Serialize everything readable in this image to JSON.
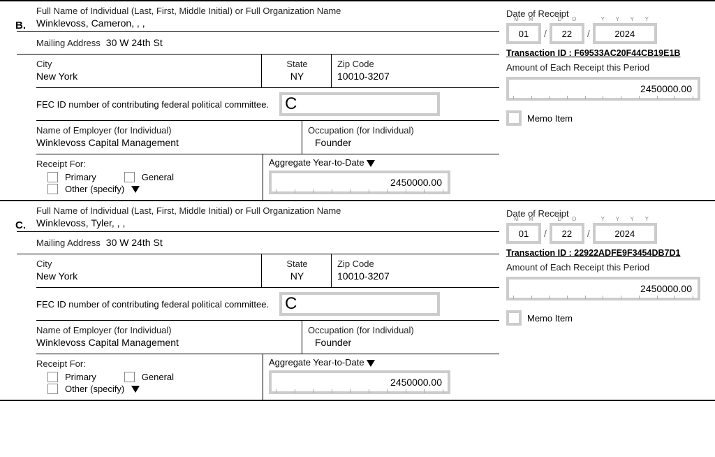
{
  "labels": {
    "fullName": "Full Name of Individual (Last, First, Middle Initial) or Full Organization Name",
    "mailingAddress": "Mailing Address",
    "city": "City",
    "state": "State",
    "zip": "Zip Code",
    "fecId": "FEC ID number of contributing federal political committee.",
    "employer": "Name of Employer (for Individual)",
    "occupation": "Occupation (for Individual)",
    "receiptFor": "Receipt For:",
    "primary": "Primary",
    "general": "General",
    "otherSpecify": "Other (specify)",
    "aggregateYtd": "Aggregate Year-to-Date",
    "dateOfReceipt": "Date of Receipt",
    "amountLabel": "Amount of Each Receipt this Period",
    "memoItem": "Memo Item",
    "transactionIdLabel": "Transaction ID :",
    "cPrefix": "C",
    "dateHeaders": {
      "m": "M",
      "d": "D",
      "y": "Y"
    }
  },
  "records": [
    {
      "letter": "B.",
      "fullName": "Winklevoss, Cameron, , ,",
      "mailingAddress": "30 W 24th St",
      "city": "New York",
      "state": "NY",
      "zip": "10010-3207",
      "fecId": "",
      "employer": "Winklevoss Capital Management",
      "occupation": "Founder",
      "aggregateYtd": "2450000.00",
      "date": {
        "mm": "01",
        "dd": "22",
        "yyyy": "2024"
      },
      "transactionId": "F69533AC20F44CB19E1B",
      "amount": "2450000.00"
    },
    {
      "letter": "C.",
      "fullName": "Winklevoss, Tyler, , ,",
      "mailingAddress": "30 W 24th St",
      "city": "New York",
      "state": "NY",
      "zip": "10010-3207",
      "fecId": "",
      "employer": "Winklevoss Capital Management",
      "occupation": "Founder",
      "aggregateYtd": "2450000.00",
      "date": {
        "mm": "01",
        "dd": "22",
        "yyyy": "2024"
      },
      "transactionId": "22922ADFE9F3454DB7D1",
      "amount": "2450000.00"
    }
  ]
}
